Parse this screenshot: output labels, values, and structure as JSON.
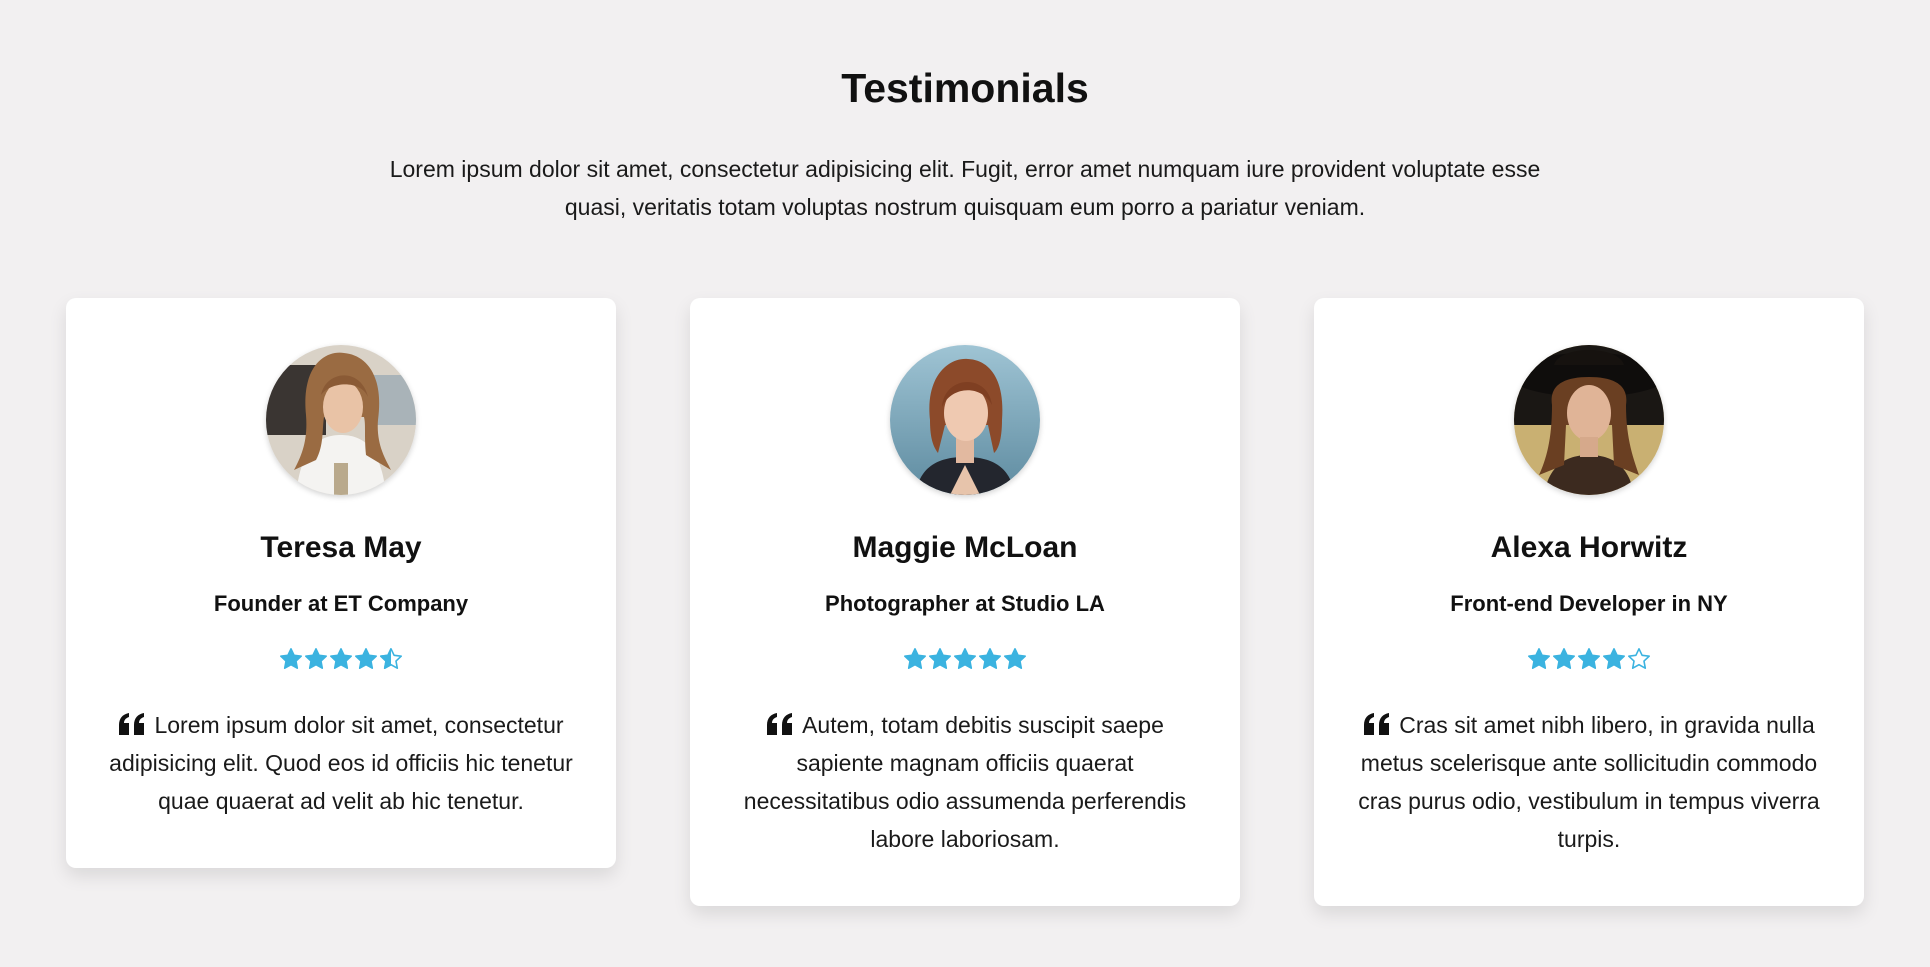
{
  "section": {
    "title": "Testimonials",
    "intro": "Lorem ipsum dolor sit amet, consectetur adipisicing elit. Fugit, error amet numquam iure provident voluptate esse quasi, veritatis totam voluptas nostrum quisquam eum porro a pariatur veniam."
  },
  "colors": {
    "background": "#f2f0f1",
    "card": "#ffffff",
    "star": "#3bb3e0",
    "text": "#111111"
  },
  "testimonials": [
    {
      "name": "Teresa May",
      "role": "Founder at ET Company",
      "rating": 4.5,
      "rating_max": 5,
      "quote": "Lorem ipsum dolor sit amet, consectetur adipisicing elit. Quod eos id officiis hic tenetur quae quaerat ad velit ab hic tenetur.",
      "avatar_icon": "portrait-photo-teresa"
    },
    {
      "name": "Maggie McLoan",
      "role": "Photographer at Studio LA",
      "rating": 5,
      "rating_max": 5,
      "quote": "Autem, totam debitis suscipit saepe sapiente magnam officiis quaerat necessitatibus odio assumenda perferendis labore laboriosam.",
      "avatar_icon": "portrait-photo-maggie"
    },
    {
      "name": "Alexa Horwitz",
      "role": "Front-end Developer in NY",
      "rating": 4,
      "rating_max": 5,
      "quote": "Cras sit amet nibh libero, in gravida nulla metus scelerisque ante sollicitudin commodo cras purus odio, vestibulum in tempus viverra turpis.",
      "avatar_icon": "portrait-photo-alexa"
    }
  ]
}
